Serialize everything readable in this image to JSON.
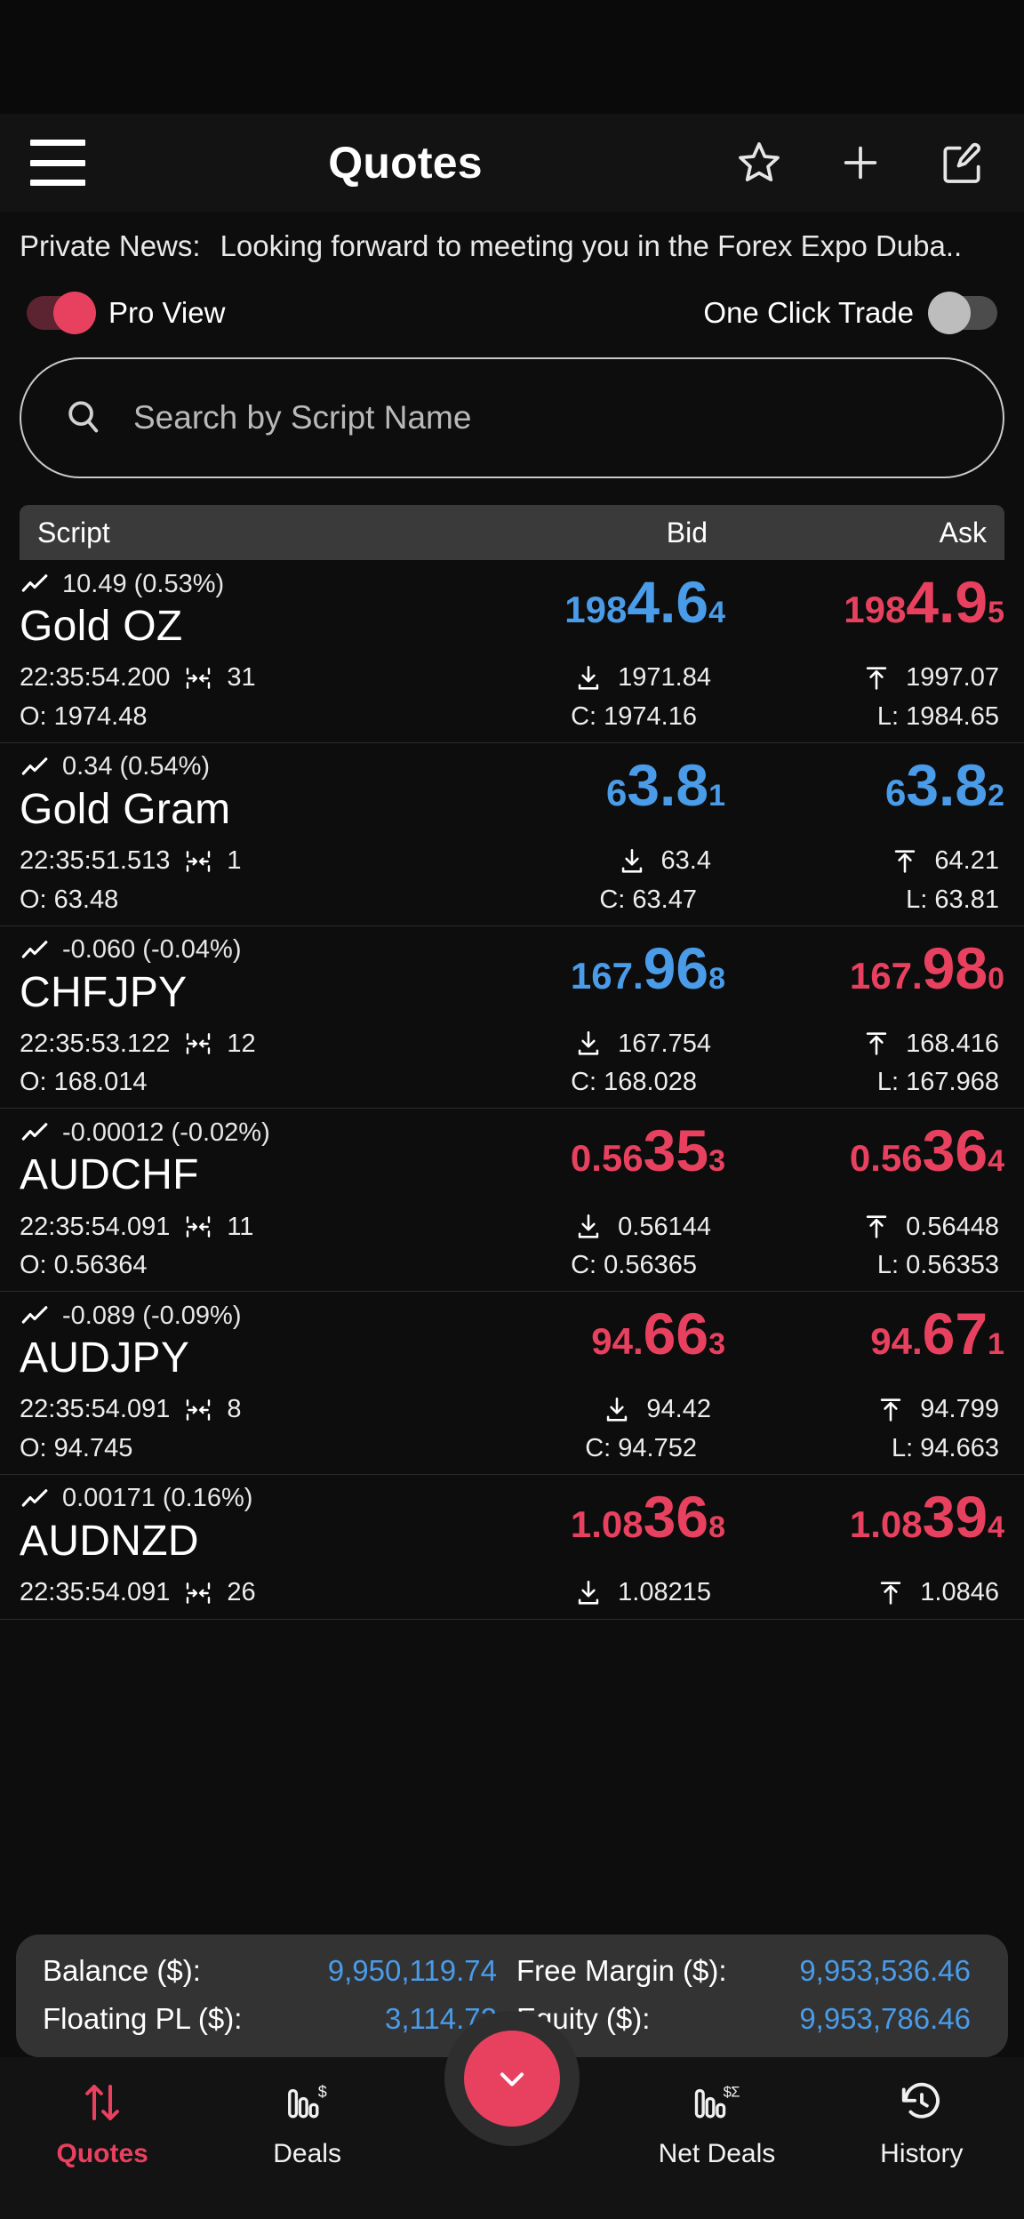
{
  "appbar": {
    "title": "Quotes",
    "menu_icon": "hamburger-icon",
    "favorite_icon": "star-icon",
    "add_icon": "plus-icon",
    "edit_icon": "edit-icon"
  },
  "news": {
    "label": "Private News:",
    "text": "Looking forward to meeting you in the Forex Expo Duba.."
  },
  "toggles": {
    "pro_view": {
      "label": "Pro View",
      "state": "on"
    },
    "one_click_trade": {
      "label": "One Click Trade",
      "state": "off"
    }
  },
  "search": {
    "placeholder": "Search by Script Name",
    "value": "",
    "icon": "search-icon"
  },
  "table": {
    "headers": {
      "script": "Script",
      "bid": "Bid",
      "ask": "Ask"
    }
  },
  "quotes": [
    {
      "symbol": "Gold OZ",
      "change": "10.49 (0.53%)",
      "time": "22:35:54.200",
      "spread": "31",
      "bid": {
        "pre": "198",
        "big": "4.6",
        "post": "4",
        "dir": "up"
      },
      "ask": {
        "pre": "198",
        "big": "4.9",
        "post": "5",
        "dir": "down"
      },
      "low": "1971.84",
      "high": "1997.07",
      "open": "O: 1974.48",
      "close": "C: 1974.16",
      "last": "L: 1984.65"
    },
    {
      "symbol": "Gold Gram",
      "change": "0.34 (0.54%)",
      "time": "22:35:51.513",
      "spread": "1",
      "bid": {
        "pre": "6",
        "big": "3.8",
        "post": "1",
        "dir": "up"
      },
      "ask": {
        "pre": "6",
        "big": "3.8",
        "post": "2",
        "dir": "up"
      },
      "low": "63.4",
      "high": "64.21",
      "open": "O: 63.48",
      "close": "C: 63.47",
      "last": "L: 63.81"
    },
    {
      "symbol": "CHFJPY",
      "change": "-0.060 (-0.04%)",
      "time": "22:35:53.122",
      "spread": "12",
      "bid": {
        "pre": "167.",
        "big": "96",
        "post": "8",
        "dir": "up"
      },
      "ask": {
        "pre": "167.",
        "big": "98",
        "post": "0",
        "dir": "down"
      },
      "low": "167.754",
      "high": "168.416",
      "open": "O: 168.014",
      "close": "C: 168.028",
      "last": "L: 167.968"
    },
    {
      "symbol": "AUDCHF",
      "change": "-0.00012 (-0.02%)",
      "time": "22:35:54.091",
      "spread": "11",
      "bid": {
        "pre": "0.56",
        "big": "35",
        "post": "3",
        "dir": "down"
      },
      "ask": {
        "pre": "0.56",
        "big": "36",
        "post": "4",
        "dir": "down"
      },
      "low": "0.56144",
      "high": "0.56448",
      "open": "O: 0.56364",
      "close": "C: 0.56365",
      "last": "L: 0.56353"
    },
    {
      "symbol": "AUDJPY",
      "change": "-0.089 (-0.09%)",
      "time": "22:35:54.091",
      "spread": "8",
      "bid": {
        "pre": "94.",
        "big": "66",
        "post": "3",
        "dir": "down"
      },
      "ask": {
        "pre": "94.",
        "big": "67",
        "post": "1",
        "dir": "down"
      },
      "low": "94.42",
      "high": "94.799",
      "open": "O: 94.745",
      "close": "C: 94.752",
      "last": "L: 94.663"
    },
    {
      "symbol": "AUDNZD",
      "change": "0.00171 (0.16%)",
      "time": "22:35:54.091",
      "spread": "26",
      "bid": {
        "pre": "1.08",
        "big": "36",
        "post": "8",
        "dir": "down"
      },
      "ask": {
        "pre": "1.08",
        "big": "39",
        "post": "4",
        "dir": "down"
      },
      "low": "1.08215",
      "high": "1.0846",
      "open": "",
      "close": "",
      "last": ""
    }
  ],
  "account": {
    "balance_label": "Balance ($):",
    "balance_value": "9,950,119.74",
    "free_margin_label": "Free Margin ($):",
    "free_margin_value": "9,953,536.46",
    "floating_pl_label": "Floating PL ($):",
    "floating_pl_value": "3,114.72",
    "equity_label": "Equity ($):",
    "equity_value": "9,953,786.46"
  },
  "nav": {
    "items": [
      {
        "label": "Quotes",
        "icon": "arrows-up-down-icon",
        "active": true
      },
      {
        "label": "Deals",
        "icon": "bars-dollar-icon",
        "active": false
      },
      {
        "label": "Net Deals",
        "icon": "bars-dollar-sigma-icon",
        "active": false
      },
      {
        "label": "History",
        "icon": "clock-rotate-left-icon",
        "active": false
      }
    ],
    "fab_icon": "chevron-down-icon"
  },
  "colors": {
    "up": "#4a9be8",
    "down": "#e8415f",
    "accent": "#e8415f",
    "background": "#0d0d0d",
    "panel": "#333333"
  }
}
